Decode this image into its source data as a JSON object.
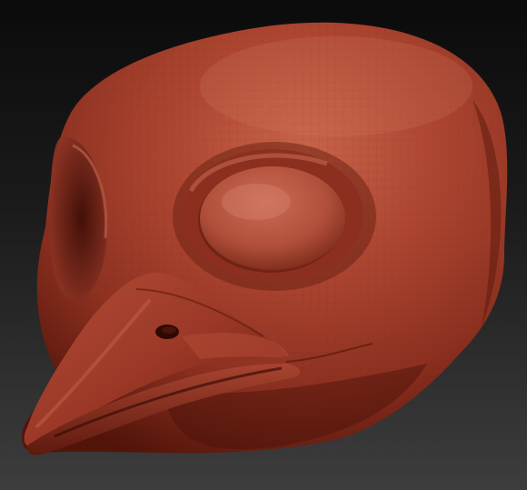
{
  "scene": {
    "subject": "clay-sculpt-bird-mask",
    "colors": {
      "background_top": "#0b0b0b",
      "background_bottom": "#3d3d3d",
      "clay_base": "#9c3a29",
      "clay_light": "#c46048",
      "clay_highlight": "#d97f66",
      "clay_shadow": "#4f150b",
      "clay_deep_shadow": "#2e0904",
      "wireframe": "#7a2a1c"
    }
  }
}
